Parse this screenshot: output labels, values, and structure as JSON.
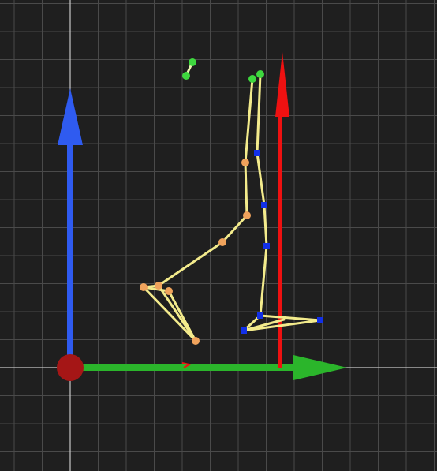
{
  "viewport": {
    "background_color": "#1f1f1f",
    "grid_color": "#4a4a4a",
    "axis_line_color": "#c8c8c8"
  },
  "gizmo": {
    "origin_icon": "red-sphere-origin-icon",
    "x_axis": {
      "icon": "green-arrow-icon",
      "color": "#2bb52b"
    },
    "y_axis": {
      "icon": "blue-arrow-icon",
      "color": "#2f5bf0"
    },
    "z_axis": {
      "icon": "red-arrow-icon",
      "color": "#ee1111"
    },
    "origin_color": "#a51616"
  },
  "skeleton": {
    "bone_color": "#f3eb8c",
    "left_leg_joint_color": "#f0a35c",
    "right_leg_joint_color": "#1230e8",
    "head_joint_color": "#3ed83e"
  }
}
